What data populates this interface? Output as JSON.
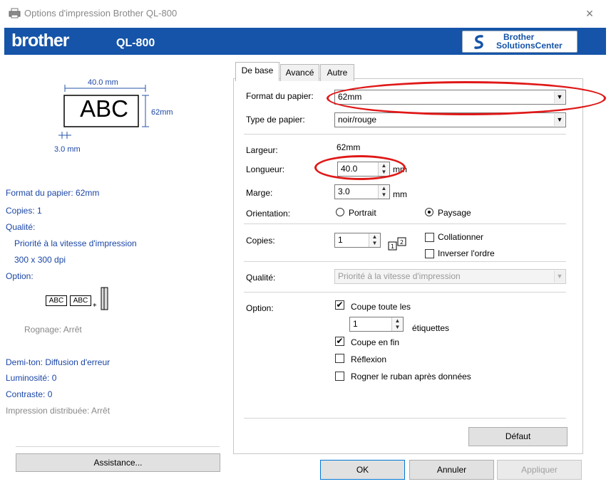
{
  "window": {
    "title": "Options d'impression Brother QL-800",
    "close": "×"
  },
  "banner": {
    "brand": "brother",
    "model": "QL-800",
    "solutions_line1": "Brother",
    "solutions_line2": "SolutionsCenter",
    "accent": "#1554a8"
  },
  "preview": {
    "width": "40.0 mm",
    "height": "62mm",
    "margin": "3.0 mm",
    "sample": "ABC"
  },
  "summary": {
    "format": "Format du papier: 62mm",
    "copies": "Copies: 1",
    "quality_label": "Qualité:",
    "quality_value": "Priorité à la vitesse d'impression",
    "dpi": "300 x 300 dpi",
    "option_label": "Option:",
    "option_sample": "ABC",
    "trim": "Rognage: Arrêt",
    "halftone": "Demi-ton: Diffusion d'erreur",
    "brightness": "Luminosité:  0",
    "contrast": "Contraste:  0",
    "distributed": "Impression distribuée: Arrêt"
  },
  "assistance_label": "Assistance...",
  "tabs": [
    "De base",
    "Avancé",
    "Autre"
  ],
  "form": {
    "paper_format_label": "Format du papier:",
    "paper_format_value": "62mm",
    "paper_type_label": "Type de papier:",
    "paper_type_value": "noir/rouge",
    "width_label": "Largeur:",
    "width_value": "62mm",
    "length_label": "Longueur:",
    "length_value": "40.0",
    "length_unit": "mm",
    "margin_label": "Marge:",
    "margin_value": "3.0",
    "margin_unit": "mm",
    "orientation_label": "Orientation:",
    "portrait": "Portrait",
    "landscape": "Paysage",
    "orientation_selected": "Paysage",
    "copies_label": "Copies:",
    "copies_value": "1",
    "collate": "Collationner",
    "collate_checked": false,
    "reverse": "Inverser l'ordre",
    "reverse_checked": false,
    "quality_label": "Qualité:",
    "quality_value": "Priorité à la vitesse d'impression",
    "option_label": "Option:",
    "cut_every": "Coupe toute les",
    "cut_every_checked": true,
    "cut_count": "1",
    "labels_unit": "étiquettes",
    "cut_end": "Coupe en fin",
    "cut_end_checked": true,
    "mirror": "Réflexion",
    "mirror_checked": false,
    "trim_tape": "Rogner le ruban après données",
    "trim_tape_checked": false
  },
  "buttons": {
    "default": "Défaut",
    "ok": "OK",
    "cancel": "Annuler",
    "apply": "Appliquer"
  },
  "annotation_color": "#e01818"
}
